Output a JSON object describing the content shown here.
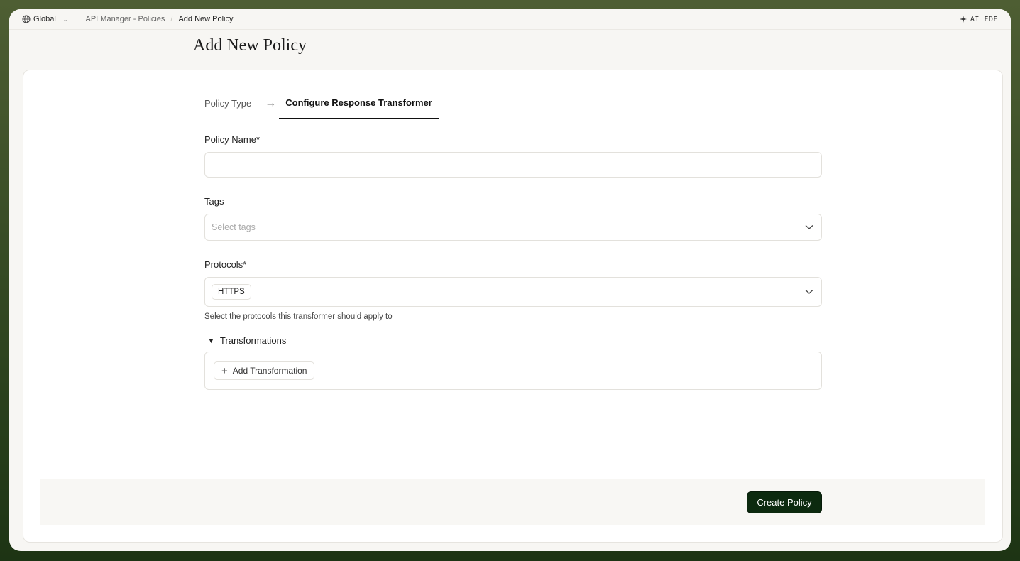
{
  "topbar": {
    "workspace": "Global",
    "breadcrumbs": [
      "API Manager - Policies",
      "Add New Policy"
    ],
    "assistant_label": "AI FDE"
  },
  "page": {
    "title": "Add New Policy"
  },
  "steps": [
    {
      "label": "Policy Type",
      "active": false
    },
    {
      "label": "Configure Response Transformer",
      "active": true
    }
  ],
  "form": {
    "policy_name": {
      "label": "Policy Name*",
      "value": ""
    },
    "tags": {
      "label": "Tags",
      "placeholder": "Select tags"
    },
    "protocols": {
      "label": "Protocols*",
      "selected": [
        "HTTPS"
      ],
      "help": "Select the protocols this transformer should apply to"
    },
    "transformations": {
      "label": "Transformations",
      "add_label": "Add Transformation"
    }
  },
  "footer": {
    "create_label": "Create Policy"
  },
  "colors": {
    "primary": "#0c2a0f",
    "background": "#f7f6f3"
  }
}
